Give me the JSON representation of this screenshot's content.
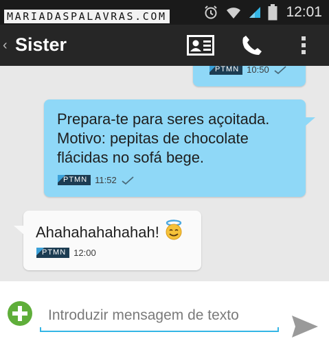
{
  "watermark": "MARIADASPALAVRAS.COM",
  "status_bar": {
    "time": "12:01",
    "icons": [
      "alarm-icon",
      "wifi-icon",
      "signal-icon",
      "battery-icon"
    ]
  },
  "action_bar": {
    "back_glyph": "‹",
    "title": "Sister",
    "actions": [
      "contact-card-icon",
      "phone-icon",
      "overflow-menu-icon"
    ]
  },
  "messages": [
    {
      "direction": "sent",
      "text": "",
      "operator": "PTMN",
      "time": "10:50",
      "status": "sent-check"
    },
    {
      "direction": "sent",
      "text": "Prepara-te para seres açoitada.\nMotivo: pepitas de chocolate\nflácidas no sofá bege.",
      "operator": "PTMN",
      "time": "11:52",
      "status": "sent-check"
    },
    {
      "direction": "received",
      "text": "Ahahahahahahah!",
      "emoji": "smiling-face-with-halo-icon",
      "operator": "PTMN",
      "time": "12:00"
    }
  ],
  "composer": {
    "placeholder": "Introduzir mensagem de texto",
    "value": ""
  },
  "colors": {
    "status_bar_bg": "#1a1a1a",
    "action_bar_bg": "#262626",
    "conversation_bg": "#e8e8e8",
    "sent_bubble": "#8fd8f7",
    "received_bubble": "#fafafa",
    "accent": "#33b5e5",
    "add_button": "#5fae3a"
  }
}
